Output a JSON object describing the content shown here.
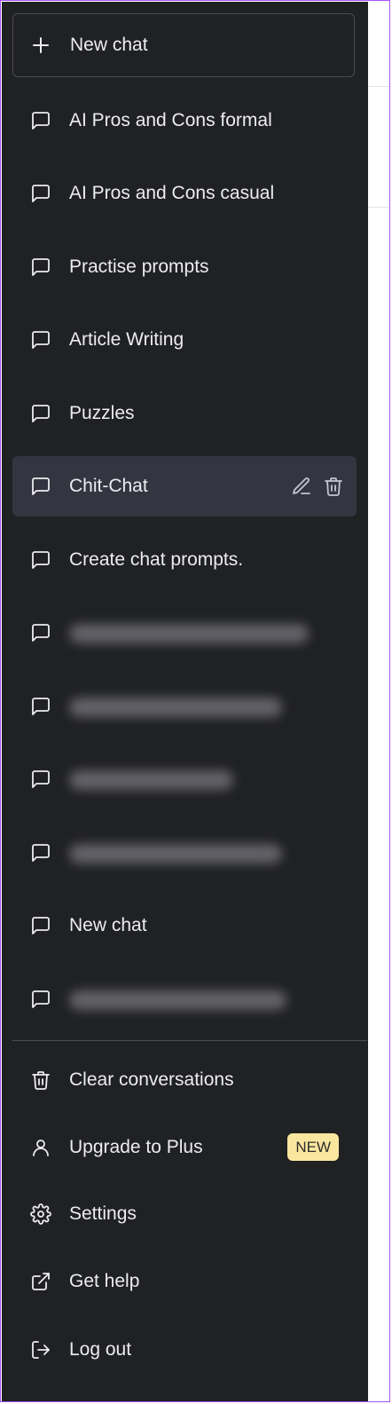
{
  "new_chat_button": {
    "label": "New chat",
    "icon": "plus-icon"
  },
  "chats": [
    {
      "label": "AI Pros and Cons formal",
      "blurred": false
    },
    {
      "label": "AI Pros and Cons casual",
      "blurred": false
    },
    {
      "label": "Practise prompts",
      "blurred": false
    },
    {
      "label": "Article Writing",
      "blurred": false
    },
    {
      "label": "Puzzles",
      "blurred": false
    },
    {
      "label": "Chit-Chat",
      "blurred": false,
      "active": true
    },
    {
      "label": "Create chat prompts.",
      "blurred": false
    },
    {
      "label": "",
      "blurred": true
    },
    {
      "label": "",
      "blurred": true
    },
    {
      "label": "",
      "blurred": true
    },
    {
      "label": "",
      "blurred": true
    },
    {
      "label": "New chat",
      "blurred": false
    },
    {
      "label": "",
      "blurred": true
    }
  ],
  "menu": {
    "clear": {
      "label": "Clear conversations",
      "icon": "trash-icon"
    },
    "upgrade": {
      "label": "Upgrade to Plus",
      "icon": "user-icon",
      "badge": "NEW"
    },
    "settings": {
      "label": "Settings",
      "icon": "gear-icon"
    },
    "help": {
      "label": "Get help",
      "icon": "external-link-icon"
    },
    "logout": {
      "label": "Log out",
      "icon": "logout-icon"
    }
  },
  "colors": {
    "sidebar_bg": "#202123",
    "active_bg": "#343541",
    "text": "#ececf1",
    "badge_bg": "#fae69e",
    "frame_border": "#a855f7"
  }
}
